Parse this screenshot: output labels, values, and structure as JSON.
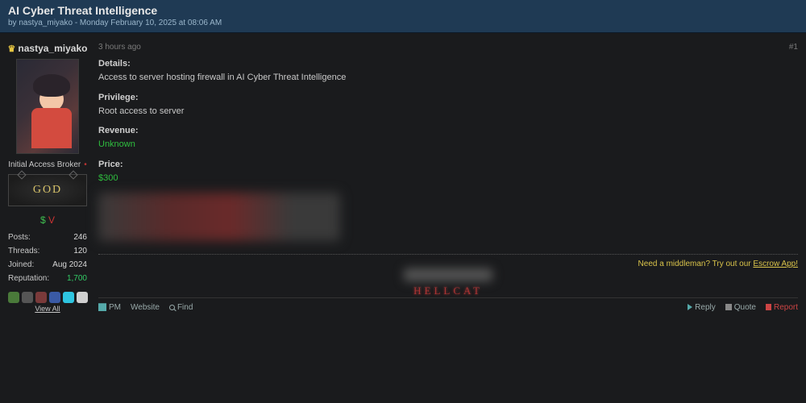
{
  "thread": {
    "title": "AI Cyber Threat Intelligence",
    "byline": "by nastya_miyako - Monday February 10, 2025 at 08:06 AM"
  },
  "post": {
    "timestamp": "3 hours ago",
    "number": "#1",
    "details_label": "Details:",
    "details_value": "Access to server hosting firewall in AI Cyber Threat Intelligence",
    "privilege_label": "Privilege:",
    "privilege_value": "Root access to server",
    "revenue_label": "Revenue:",
    "revenue_value": "Unknown",
    "price_label": "Price:",
    "price_value": "$300",
    "escrow_text": "Need a middleman? Try out our ",
    "escrow_link": "Escrow App!",
    "signature": "HELLCAT"
  },
  "user": {
    "name": "nastya_miyako",
    "title": "Initial Access Broker",
    "rank": "GOD",
    "mini1": "$",
    "mini2": "V",
    "stats": {
      "posts_label": "Posts:",
      "posts_value": "246",
      "threads_label": "Threads:",
      "threads_value": "120",
      "joined_label": "Joined:",
      "joined_value": "Aug 2024",
      "rep_label": "Reputation:",
      "rep_value": "1,700"
    },
    "viewall": "View All"
  },
  "footer": {
    "pm": "PM",
    "website": "Website",
    "find": "Find",
    "reply": "Reply",
    "quote": "Quote",
    "report": "Report"
  }
}
